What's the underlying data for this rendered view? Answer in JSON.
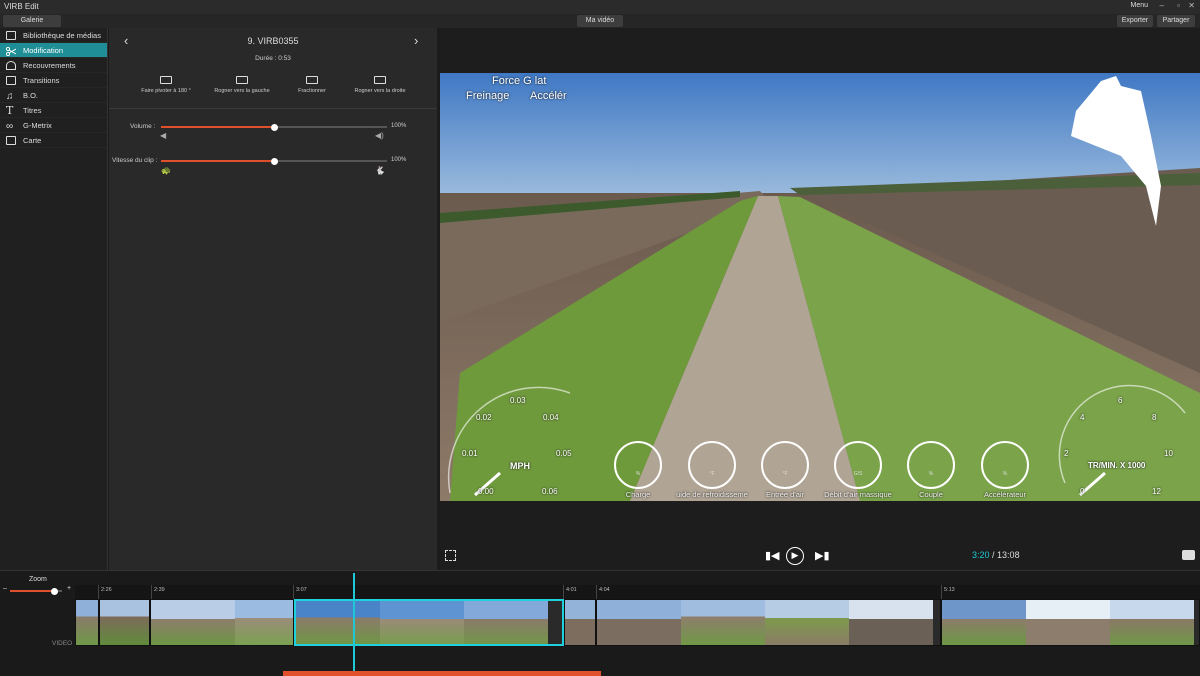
{
  "app": {
    "title": "VIRB Edit",
    "menu": "Menu",
    "window_controls": [
      "–",
      "▫",
      "✕"
    ]
  },
  "toolbar": {
    "gallery": "Galerie",
    "project": "Ma vidéo",
    "export": "Exporter",
    "share": "Partager"
  },
  "sidebar": {
    "items": [
      {
        "label": "Bibliothèque de médias",
        "icon": "media-library-icon"
      },
      {
        "label": "Modification",
        "icon": "scissors-icon",
        "active": true
      },
      {
        "label": "Recouvrements",
        "icon": "gauge-icon"
      },
      {
        "label": "Transitions",
        "icon": "transitions-icon"
      },
      {
        "label": "B.O.",
        "icon": "music-note-icon"
      },
      {
        "label": "Titres",
        "icon": "title-t-icon"
      },
      {
        "label": "G-Metrix",
        "icon": "gmetrix-icon"
      },
      {
        "label": "Carte",
        "icon": "map-icon"
      }
    ]
  },
  "edit": {
    "clip_name": "9. VIRB0355",
    "duration": "Durée : 0:53",
    "tools": [
      "Faire pivoter à 180 °",
      "Rogner vers la gauche",
      "Fractionner",
      "Rogner vers la droite"
    ],
    "volume_label": "Volume :",
    "volume_value": "100%",
    "volume_level": 0.5,
    "speed_label": "Vitesse du clip :",
    "speed_value": "100%",
    "speed_level": 0.5
  },
  "overlay": {
    "force_label": "Force G lat",
    "brake_label": "Freinage",
    "accel_label": "Accélér",
    "speed_ticks": [
      "0.00",
      "0.01",
      "0.02",
      "0.03",
      "0.04",
      "0.05",
      "0.06"
    ],
    "speed_unit": "MPH",
    "rpm_ticks": [
      "0",
      "2",
      "4",
      "6",
      "8",
      "10",
      "12"
    ],
    "rpm_unit": "TR/MIN. X 1000",
    "gauges": [
      {
        "label": "Charge",
        "unit": "%"
      },
      {
        "label": "uide de refroidisseme",
        "unit": "°F"
      },
      {
        "label": "Entrée d'air",
        "unit": "°F"
      },
      {
        "label": "Débit d'air massique",
        "unit": "G/S"
      },
      {
        "label": "Couple",
        "unit": "%"
      },
      {
        "label": "Accélérateur",
        "unit": "%"
      }
    ]
  },
  "player": {
    "current_time": "3:20",
    "separator": " / ",
    "total_time": "13:08"
  },
  "timeline": {
    "zoom_label": "Zoom",
    "zoom_minus": "–",
    "zoom_plus": "+",
    "track_label": "VIDEO",
    "ticks": [
      "2:26",
      "2:39",
      "3:07",
      "4:01",
      "4:04",
      "5:13"
    ]
  },
  "colors": {
    "accent": "#1f8e97",
    "slider": "#e0502d",
    "selection": "#1ed1dd"
  }
}
